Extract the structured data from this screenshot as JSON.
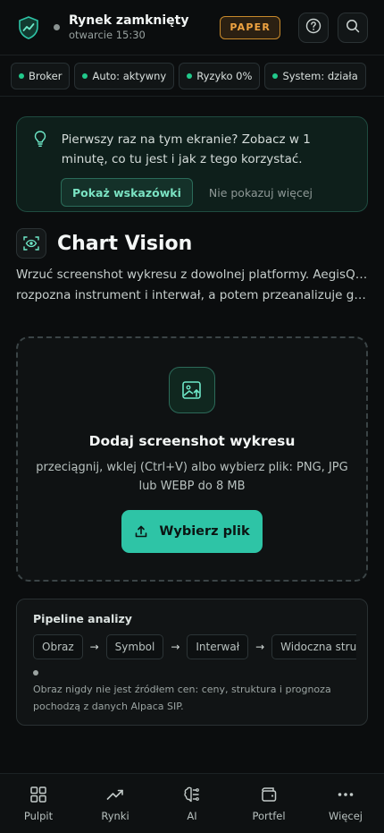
{
  "header": {
    "market_status": "Rynek zamknięty",
    "market_opens": "otwarcie 15:30",
    "mode_badge": "PAPER",
    "icons": [
      "shield-chart-logo-icon",
      "help-icon",
      "search-icon"
    ]
  },
  "status_chips": [
    {
      "label": "Broker"
    },
    {
      "label": "Auto: aktywny"
    },
    {
      "label": "Ryzyko 0%"
    },
    {
      "label": "System: działa"
    }
  ],
  "tip": {
    "text": "Pierwszy raz na tym ekranie? Zobacz w 1 minutę, co tu jest i jak z tego korzystać.",
    "primary_button": "Pokaż wskazówki",
    "secondary_link": "Nie pokazuj więcej"
  },
  "section": {
    "title": "Chart Vision",
    "description_line1": "Wrzuć screenshot wykresu z dowolnej platformy. AegisQuant",
    "description_line2": "rozpozna instrument i interwał, a potem przeanalizuje go na..."
  },
  "dropzone": {
    "title": "Dodaj screenshot wykresu",
    "subtitle": "przeciągnij, wklej (Ctrl+V) albo wybierz plik: PNG, JPG lub WEBP do 8 MB",
    "button": "Wybierz plik"
  },
  "pipeline": {
    "title": "Pipeline analizy",
    "steps": [
      "Obraz",
      "Symbol",
      "Interwał",
      "Widoczna struktura"
    ],
    "note": "Obraz nigdy nie jest źródłem cen: ceny, struktura i prognoza pochodzą z danych Alpaca SIP."
  },
  "nav": [
    {
      "label": "Pulpit",
      "icon": "grid-icon"
    },
    {
      "label": "Rynki",
      "icon": "trend-icon"
    },
    {
      "label": "AI",
      "icon": "brain-icon"
    },
    {
      "label": "Portfel",
      "icon": "wallet-icon"
    },
    {
      "label": "Więcej",
      "icon": "more-icon"
    }
  ],
  "colors": {
    "accent": "#2ec4a6",
    "status_ok": "#21c98b",
    "paper_badge": "#f0a441",
    "background": "#0b0d0e"
  }
}
